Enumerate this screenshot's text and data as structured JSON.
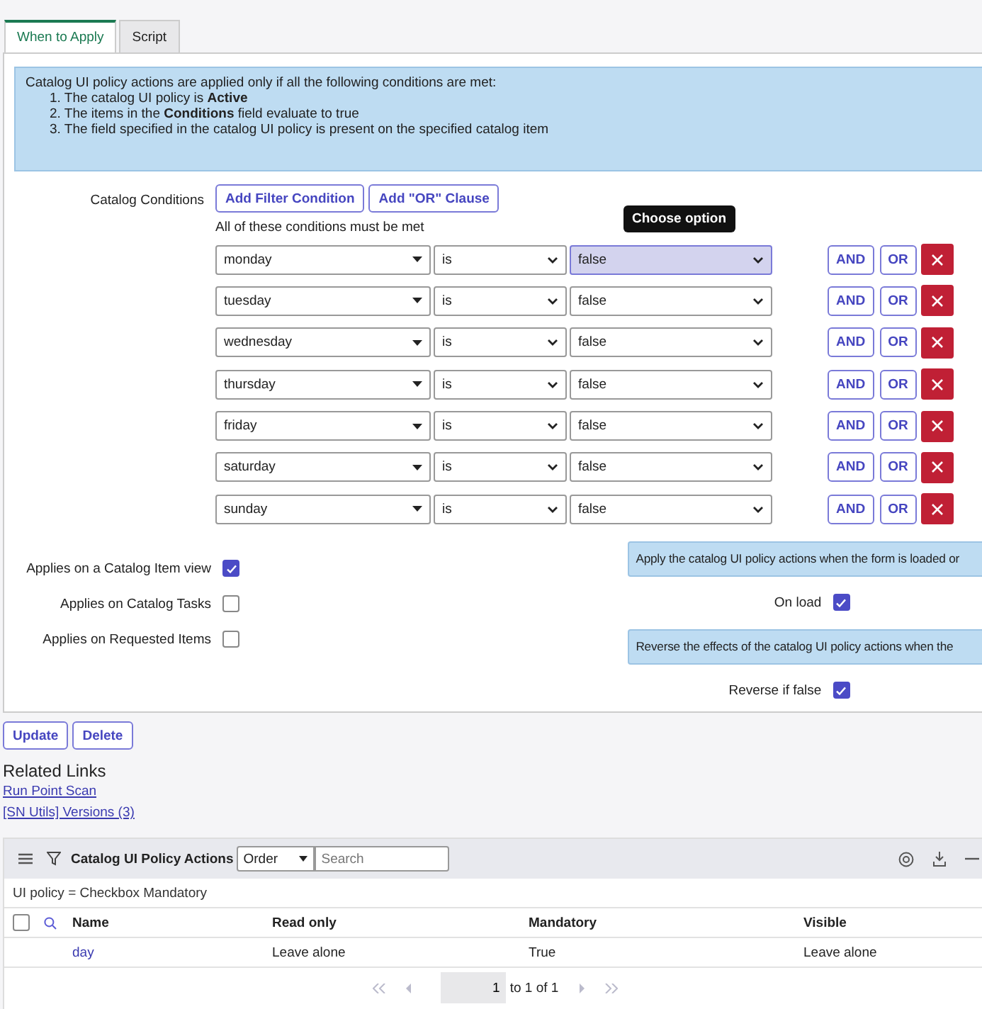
{
  "tabs": [
    {
      "label": "When to Apply",
      "selected": true
    },
    {
      "label": "Script",
      "selected": false
    }
  ],
  "info": {
    "lead": "Catalog UI policy actions are applied only if all the following conditions are met:",
    "items": [
      "1. The catalog UI policy is **Active**",
      "2. The items in the **Conditions** field evaluate to true",
      "3. The field specified in the catalog UI policy is present on the specified catalog item"
    ]
  },
  "conditions": {
    "label": "Catalog Conditions",
    "buttons": [
      "Add Filter Condition",
      "Add \"OR\" Clause"
    ],
    "summary": "All of these conditions must be met",
    "tooltip": "Choose option",
    "rows": [
      {
        "field": "monday",
        "operator": "is",
        "value": "false",
        "focused": true,
        "and": "AND",
        "or": "OR"
      },
      {
        "field": "tuesday",
        "operator": "is",
        "value": "false",
        "focused": false,
        "and": "AND",
        "or": "OR"
      },
      {
        "field": "wednesday",
        "operator": "is",
        "value": "false",
        "focused": false,
        "and": "AND",
        "or": "OR"
      },
      {
        "field": "thursday",
        "operator": "is",
        "value": "false",
        "focused": false,
        "and": "AND",
        "or": "OR"
      },
      {
        "field": "friday",
        "operator": "is",
        "value": "false",
        "focused": false,
        "and": "AND",
        "or": "OR"
      },
      {
        "field": "saturday",
        "operator": "is",
        "value": "false",
        "focused": false,
        "and": "AND",
        "or": "OR"
      },
      {
        "field": "sunday",
        "operator": "is",
        "value": "false",
        "focused": false,
        "and": "AND",
        "or": "OR"
      }
    ]
  },
  "applies": [
    {
      "label": "Applies on a Catalog Item view",
      "checked": true
    },
    {
      "label": "Applies on Catalog Tasks",
      "checked": false
    },
    {
      "label": "Applies on Requested Items",
      "checked": false
    }
  ],
  "options": [
    {
      "kind": "hint",
      "text": "Apply the catalog UI policy actions when the form is loaded or"
    },
    {
      "kind": "checkbox",
      "label": "On load",
      "checked": true
    },
    {
      "kind": "hint",
      "text": "Reverse the effects of the catalog UI policy actions when the"
    },
    {
      "kind": "checkbox",
      "label": "Reverse if false",
      "checked": true
    }
  ],
  "actions": [
    "Update",
    "Delete"
  ],
  "related": {
    "title": "Related Links",
    "links": [
      "Run Point Scan",
      "[SN Utils] Versions (3)"
    ]
  },
  "list": {
    "title": "Catalog UI Policy Actions",
    "order": "Order",
    "search_placeholder": "Search",
    "filter": "UI policy = Checkbox Mandatory",
    "select_all": {
      "checked": false
    },
    "columns": [
      "Name",
      "Read only",
      "Mandatory",
      "Visible"
    ],
    "rows": [
      [
        "day",
        "Leave alone",
        "True",
        "Leave alone"
      ]
    ],
    "page": "1",
    "range": "to 1 of 1"
  }
}
